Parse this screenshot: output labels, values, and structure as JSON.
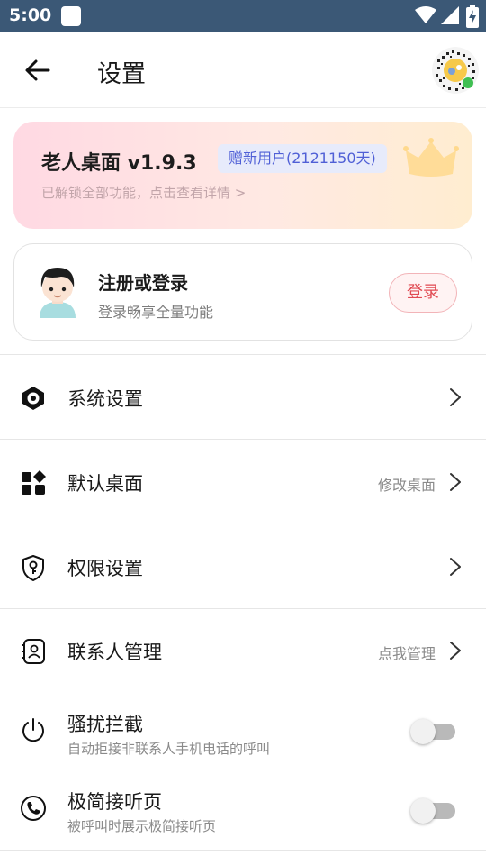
{
  "status_bar": {
    "time": "5:00",
    "icons": [
      "notification-icon",
      "wifi-icon",
      "cellular-icon",
      "battery-charging-icon"
    ]
  },
  "app_bar": {
    "title": "设置",
    "back_icon": "arrow-left-icon",
    "right_icon": "qr-code-avatar-icon"
  },
  "vip_card": {
    "app_name": "老人桌面 v1.9.3",
    "badge": "赠新用户(2121150天)",
    "subtitle": "已解锁全部功能，点击查看详情 >",
    "icon": "crown-icon"
  },
  "login_card": {
    "title": "注册或登录",
    "subtitle": "登录畅享全量功能",
    "button_label": "登录",
    "avatar_icon": "boy-avatar-icon"
  },
  "settings": [
    {
      "label": "系统设置",
      "extra": "",
      "icon": "gear-hexagon-icon"
    },
    {
      "label": "默认桌面",
      "extra": "修改桌面",
      "icon": "app-grid-icon"
    },
    {
      "label": "权限设置",
      "extra": "",
      "icon": "shield-key-icon"
    },
    {
      "label": "联系人管理",
      "extra": "点我管理",
      "icon": "contact-book-icon"
    }
  ],
  "toggles": [
    {
      "label": "骚扰拦截",
      "description": "自动拒接非联系人手机电话的呼叫",
      "icon": "power-icon",
      "enabled": false
    },
    {
      "label": "极简接听页",
      "description": "被呼叫时展示极简接听页",
      "icon": "phone-icon",
      "enabled": false
    }
  ],
  "colors": {
    "status_bar": "#3b5876",
    "badge_text": "#4f5fd6",
    "login_button": "#e04a52",
    "toggle_off": "#b9b9b9"
  }
}
